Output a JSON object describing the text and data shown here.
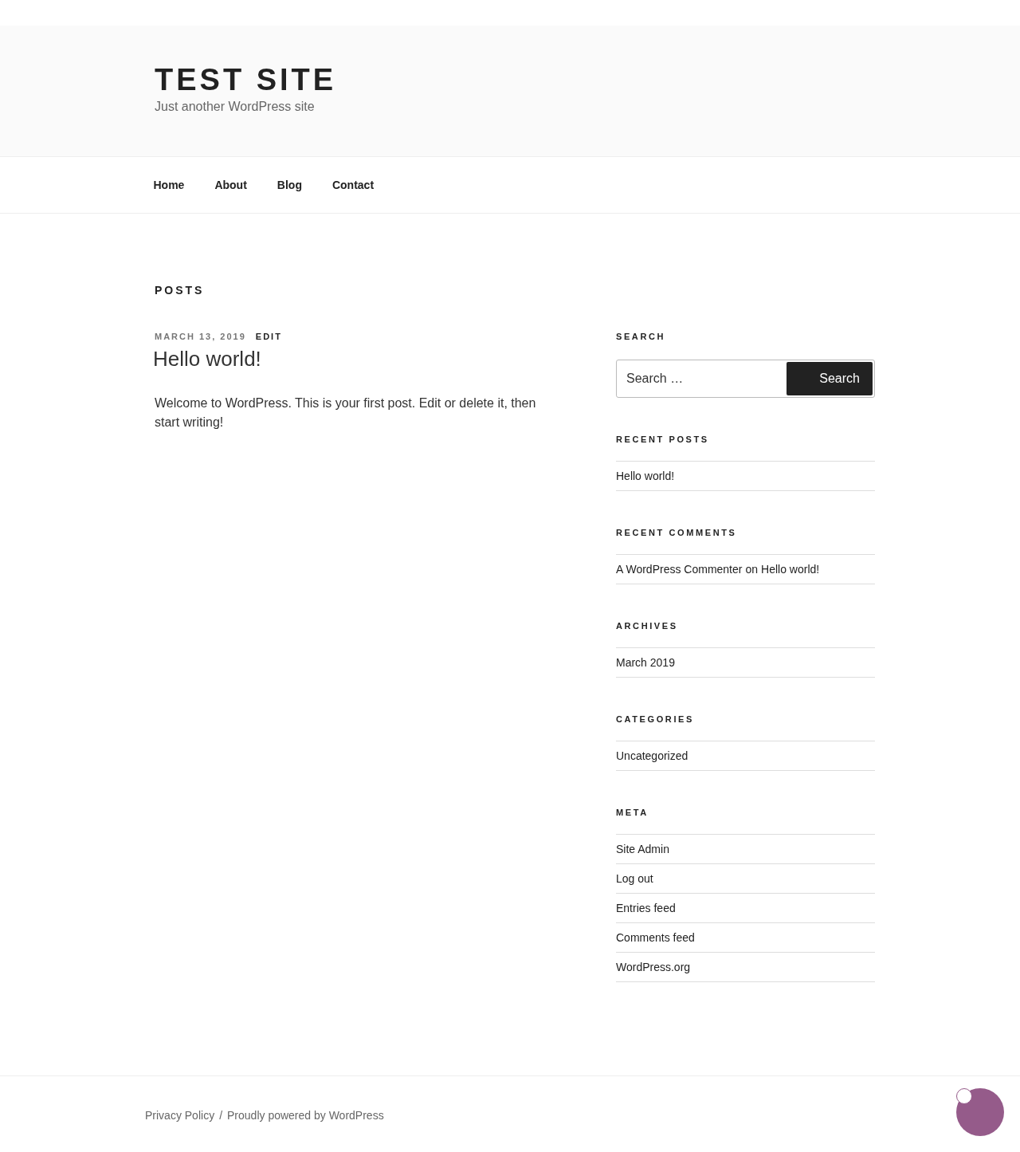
{
  "header": {
    "title": "TEST SITE",
    "tagline": "Just another WordPress site"
  },
  "nav": [
    {
      "label": "Home"
    },
    {
      "label": "About"
    },
    {
      "label": "Blog"
    },
    {
      "label": "Contact"
    }
  ],
  "page_heading": "POSTS",
  "posts": [
    {
      "date": "MARCH 13, 2019",
      "edit": "EDIT",
      "title": "Hello world!",
      "body": "Welcome to WordPress. This is your first post. Edit or delete it, then start writing!"
    }
  ],
  "sidebar": {
    "search": {
      "title": "SEARCH",
      "placeholder": "Search …",
      "button": "Search"
    },
    "widgets": [
      {
        "title": "RECENT POSTS",
        "items": [
          {
            "kind": "link",
            "text": "Hello world!"
          }
        ]
      },
      {
        "title": "RECENT COMMENTS",
        "items": [
          {
            "kind": "comment",
            "author": "A WordPress Commenter",
            "joiner": "on",
            "post": "Hello world!"
          }
        ]
      },
      {
        "title": "ARCHIVES",
        "items": [
          {
            "kind": "link",
            "text": "March 2019"
          }
        ]
      },
      {
        "title": "CATEGORIES",
        "items": [
          {
            "kind": "link",
            "text": "Uncategorized"
          }
        ]
      },
      {
        "title": "META",
        "items": [
          {
            "kind": "link",
            "text": "Site Admin"
          },
          {
            "kind": "link",
            "text": "Log out"
          },
          {
            "kind": "link",
            "text": "Entries feed"
          },
          {
            "kind": "link",
            "text": "Comments feed"
          },
          {
            "kind": "link",
            "text": "WordPress.org"
          }
        ]
      }
    ]
  },
  "footer": {
    "links": [
      "Privacy Policy",
      "Proudly powered by WordPress"
    ],
    "separator": "/"
  }
}
